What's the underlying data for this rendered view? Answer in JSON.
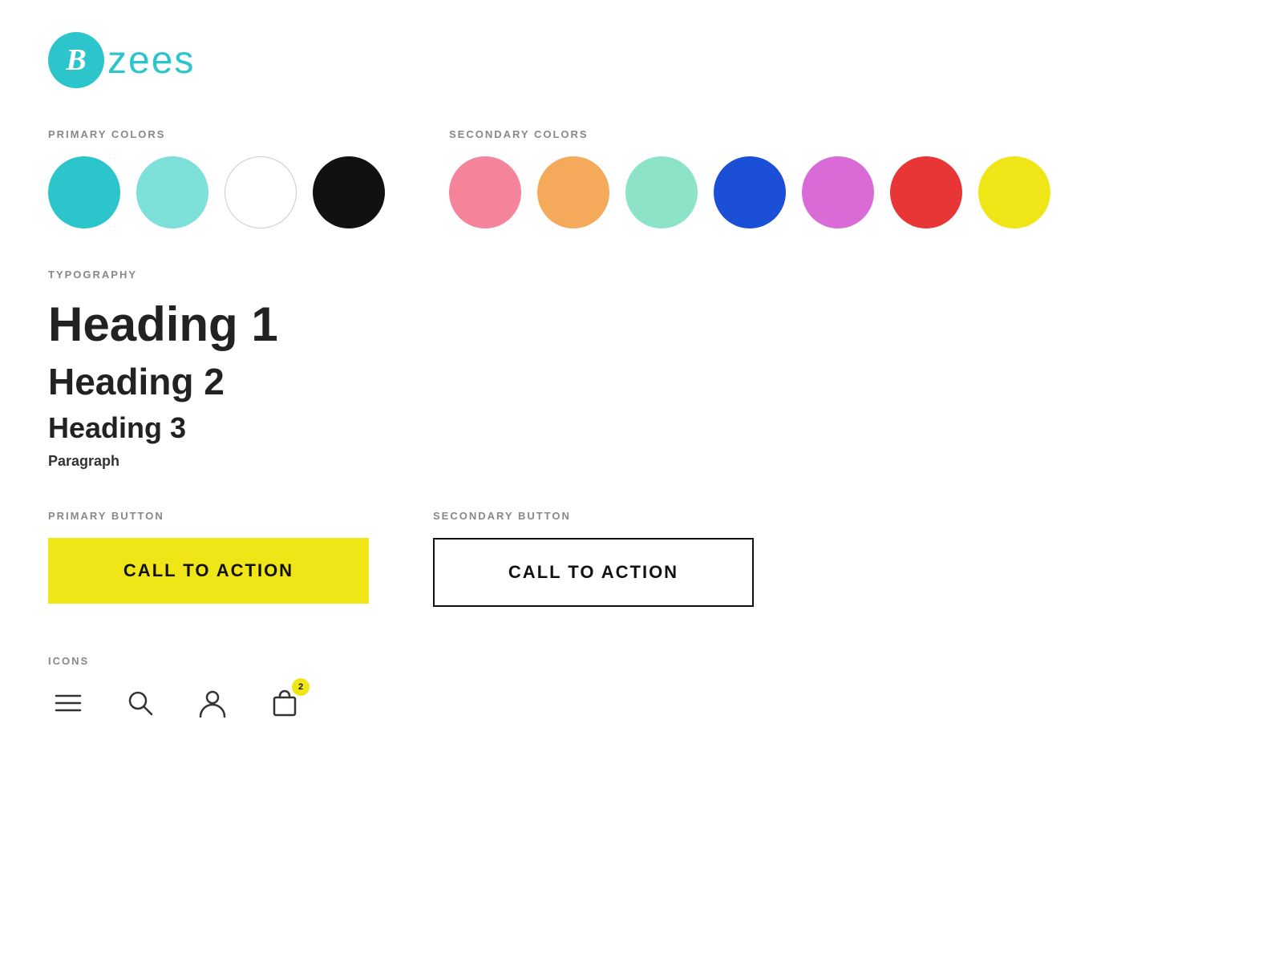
{
  "logo": {
    "b_letter": "B",
    "text": "zees"
  },
  "primary_colors": {
    "label": "PRIMARY COLORS",
    "swatches": [
      {
        "color": "#2dc5cc",
        "name": "teal"
      },
      {
        "color": "#7de0d9",
        "name": "light-teal"
      },
      {
        "color": "#ffffff",
        "name": "white",
        "border": true
      },
      {
        "color": "#111111",
        "name": "black"
      }
    ]
  },
  "secondary_colors": {
    "label": "SECONDARY COLORS",
    "swatches": [
      {
        "color": "#f5839a",
        "name": "pink"
      },
      {
        "color": "#f5a95a",
        "name": "orange"
      },
      {
        "color": "#8de3c8",
        "name": "mint"
      },
      {
        "color": "#1a4fd6",
        "name": "blue"
      },
      {
        "color": "#d96ad6",
        "name": "purple"
      },
      {
        "color": "#e83535",
        "name": "red"
      },
      {
        "color": "#f0e617",
        "name": "yellow"
      }
    ]
  },
  "typography": {
    "label": "TYPOGRAPHY",
    "heading1": "Heading 1",
    "heading2": "Heading 2",
    "heading3": "Heading 3",
    "paragraph": "Paragraph"
  },
  "primary_button": {
    "label": "PRIMARY BUTTON",
    "text": "CALL TO ACTION"
  },
  "secondary_button": {
    "label": "SECONDARY BUTTON",
    "text": "CALL TO ACTION"
  },
  "icons": {
    "label": "ICONS",
    "badge_count": "2"
  }
}
